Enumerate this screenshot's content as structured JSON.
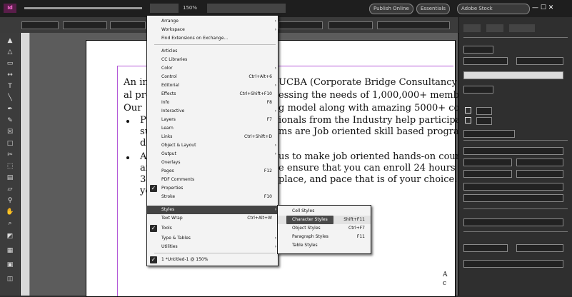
{
  "app": {
    "logo": "Id",
    "zoom": "150%",
    "publish_label": "Publish Online",
    "workspace_label": "Essentials",
    "search_placeholder": "Adobe Stock"
  },
  "menu": {
    "items": [
      {
        "label": "Arrange",
        "shortcut": "",
        "submenu": true
      },
      {
        "label": "Workspace",
        "shortcut": "",
        "submenu": true
      },
      {
        "label": "Find Extensions on Exchange...",
        "shortcut": "",
        "submenu": false
      },
      {
        "label": "Articles",
        "shortcut": "",
        "submenu": false
      },
      {
        "label": "CC Libraries",
        "shortcut": "",
        "submenu": false
      },
      {
        "label": "Color",
        "shortcut": "",
        "submenu": true
      },
      {
        "label": "Control",
        "shortcut": "Ctrl+Alt+6",
        "submenu": false
      },
      {
        "label": "Editorial",
        "shortcut": "",
        "submenu": true
      },
      {
        "label": "Effects",
        "shortcut": "Ctrl+Shift+F10",
        "submenu": false
      },
      {
        "label": "Info",
        "shortcut": "F8",
        "submenu": false
      },
      {
        "label": "Interactive",
        "shortcut": "",
        "submenu": true
      },
      {
        "label": "Layers",
        "shortcut": "F7",
        "submenu": false
      },
      {
        "label": "Learn",
        "shortcut": "",
        "submenu": false
      },
      {
        "label": "Links",
        "shortcut": "Ctrl+Shift+D",
        "submenu": false
      },
      {
        "label": "Object & Layout",
        "shortcut": "",
        "submenu": true
      },
      {
        "label": "Output",
        "shortcut": "",
        "submenu": true
      },
      {
        "label": "Overlays",
        "shortcut": "",
        "submenu": false
      },
      {
        "label": "Pages",
        "shortcut": "F12",
        "submenu": false
      },
      {
        "label": "PDF Comments",
        "shortcut": "",
        "submenu": false
      },
      {
        "label": "Properties",
        "shortcut": "",
        "submenu": false
      },
      {
        "label": "Stroke",
        "shortcut": "F10",
        "submenu": false
      },
      {
        "label": "Styles",
        "shortcut": "",
        "submenu": true
      },
      {
        "label": "Text Wrap",
        "shortcut": "Ctrl+Alt+W",
        "submenu": false
      },
      {
        "label": "Tools",
        "shortcut": "",
        "submenu": false
      },
      {
        "label": "Type & Tables",
        "shortcut": "",
        "submenu": true
      },
      {
        "label": "Utilities",
        "shortcut": "",
        "submenu": true
      },
      {
        "label": "1 *Untitled-1 @ 150%",
        "shortcut": "",
        "submenu": false
      }
    ]
  },
  "submenu": {
    "items": [
      {
        "label": "Cell Styles",
        "shortcut": ""
      },
      {
        "label": "Character Styles",
        "shortcut": "Shift+F11"
      },
      {
        "label": "Object Styles",
        "shortcut": "Ctrl+F7"
      },
      {
        "label": "Paragraph Styles",
        "shortcut": "F11"
      },
      {
        "label": "Table Styles",
        "shortcut": ""
      }
    ]
  },
  "document": {
    "line1a": "An in",
    "line1b": "UCBA (Corporate Bridge Consultancy Pvt L",
    "line2a": "al pro",
    "line2b": "essing the needs of 1,000,000+ members ac",
    "line3a": "Our",
    "line3b": "g model along with amazing 5000+ courses",
    "line4a": "P",
    "line4b": "ionals from the Industry help participants a",
    "line5a": "su",
    "line5b": "ms are Job oriented skill based programs de",
    "line6a": "d",
    "line7a": "A",
    "line7b": "us to make job oriented hands-on courses",
    "line8a": "ar",
    "line8b": "e ensure that you can enroll 24 hours a day,",
    "line9a": "36",
    "line9b": "place, and pace that is of your choice. Plan",
    "line10a": "yo",
    "footer1": "A",
    "footer2": "c"
  }
}
